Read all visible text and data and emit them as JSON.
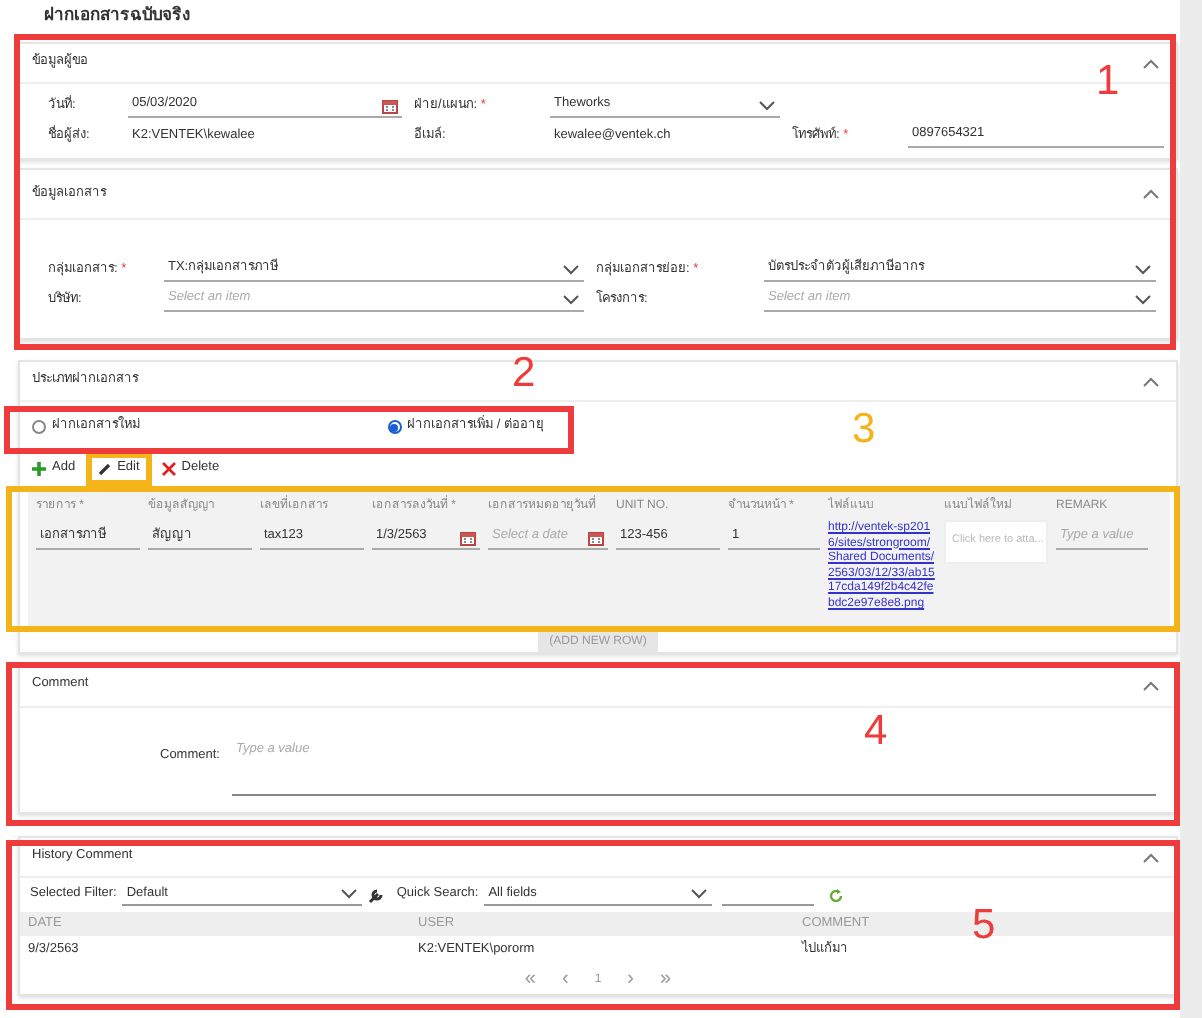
{
  "page_title": "ฝากเอกสารฉบับจริง",
  "requester": {
    "title": "ข้อมูลผู้ขอ",
    "fields": [
      {
        "label": "วันที่:",
        "kind": "date",
        "value": "05/03/2020"
      },
      {
        "label": "ฝ่าย/แผนก:",
        "required_mark": "*",
        "kind": "select",
        "value": "Theworks"
      },
      {
        "kind": "blank"
      },
      {
        "label": "ชื่อผู้ส่ง:",
        "kind": "text",
        "value": "K2:VENTEK\\kewalee"
      },
      {
        "label": "อีเมล์:",
        "kind": "text",
        "value": "kewalee@ventek.ch"
      },
      {
        "label": "โทรศัพท์:",
        "required_mark": "*",
        "kind": "input",
        "value": "0897654321"
      }
    ]
  },
  "document": {
    "title": "ข้อมูลเอกสาร",
    "fields": [
      {
        "label": "กลุ่มเอกสาร:",
        "required_mark": "*",
        "kind": "select",
        "value": "TX:กลุ่มเอกสารภาษี"
      },
      {
        "label": "กลุ่มเอกสารย่อย:",
        "required_mark": "*",
        "kind": "select",
        "value": "บัตรประจำตัวผู้เสียภาษีอากร"
      },
      {
        "label": "บริษัท:",
        "kind": "select",
        "placeholder": "Select an item"
      },
      {
        "label": "โครงการ:",
        "kind": "select",
        "placeholder": "Select an item"
      }
    ]
  },
  "deposit_type": {
    "title": "ประเภทฝากเอกสาร",
    "options": [
      {
        "label": "ฝากเอกสารใหม่",
        "selected": false
      },
      {
        "label": "ฝากเอกสารเพิ่ม / ต่ออายุ",
        "selected": true
      }
    ],
    "toolbar": [
      {
        "kind": "add",
        "label": "Add"
      },
      {
        "kind": "edit",
        "label": "Edit"
      },
      {
        "kind": "delete",
        "label": "Delete"
      }
    ],
    "table": {
      "columns": [
        "รายการ *",
        "ข้อมูลสัญญา",
        "เลขที่เอกสาร",
        "เอกสารลงวันที่ *",
        "เอกสารหมดอายุวันที่",
        "UNIT NO.",
        "จำนวนหน้า *",
        "ไฟล์แนบ",
        "แนบไฟล์ใหม่",
        "REMARK"
      ],
      "rows": [
        [
          {
            "kind": "input",
            "value": "เอกสารภาษี"
          },
          {
            "kind": "input",
            "value": "สัญญา"
          },
          {
            "kind": "input",
            "value": "tax123"
          },
          {
            "kind": "date",
            "value": "1/3/2563"
          },
          {
            "kind": "date",
            "placeholder": "Select a date"
          },
          {
            "kind": "input",
            "value": "123-456"
          },
          {
            "kind": "input",
            "value": "1"
          },
          {
            "kind": "link",
            "value": "http://ventek-sp2016/sites/strongroom/Shared Documents/2563/03/12/33/ab1517cda149f2b4c42febdc2e97e8e8.png"
          },
          {
            "kind": "attach",
            "placeholder": "Click here to atta..."
          },
          {
            "kind": "input",
            "placeholder": "Type a value"
          }
        ]
      ]
    },
    "add_row": "(ADD NEW ROW)"
  },
  "comment": {
    "title": "Comment",
    "label": "Comment:",
    "placeholder": "Type a value"
  },
  "history": {
    "title": "History Comment",
    "filter_label": "Selected Filter:",
    "filter_value": "Default",
    "search_label": "Quick Search:",
    "search_value": "All fields",
    "columns": [
      "DATE",
      "USER",
      "COMMENT"
    ],
    "rows": [
      [
        "9/3/2563",
        "K2:VENTEK\\pororm",
        "ไปแก้มา"
      ]
    ],
    "pager": [
      "«",
      "‹",
      "1",
      "›",
      "»"
    ]
  },
  "annotations": [
    {
      "label": "1",
      "color": "#ee3b3b"
    },
    {
      "label": "2",
      "color": "#ee3b3b"
    },
    {
      "label": "3",
      "color": "#f5b31a"
    },
    {
      "color": "#f5b31a"
    },
    {
      "label": "4",
      "color": "#ee3b3b"
    },
    {
      "label": "5",
      "color": "#ee3b3b"
    }
  ]
}
